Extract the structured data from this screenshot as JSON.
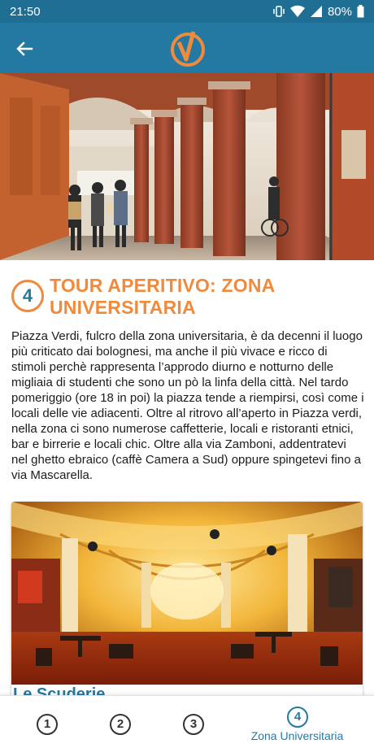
{
  "status_bar": {
    "time": "21:50",
    "battery": "80%"
  },
  "app_bar": {
    "back_icon": "arrow-left-icon",
    "logo_icon": "checkmark-circle-logo-icon",
    "colors": {
      "bar": "#2479a2",
      "status": "#1f6e93",
      "accent": "#f08a3c"
    }
  },
  "section": {
    "number": "4",
    "title": "TOUR APERITIVO: ZONA UNIVERSITARIA",
    "body": "Piazza Verdi, fulcro della zona universitaria, è da decenni il luogo più criticato dai bolognesi, ma anche il più vivace e ricco di stimoli perchè rappresenta l’approdo diurno e notturno delle migliaia di studenti che sono un pò la linfa della città. Nel tardo pomeriggio (ore 18 in poi) la piazza tende a riempirsi, così come i locali delle vie adiacenti. Oltre al ritrovo all’aperto in Piazza verdi, nella zona ci sono numerose caffetterie, locali e ristoranti etnici, bar e birrerie e locali chic. Oltre alla via Zamboni, addentratevi nel ghetto ebraico (caffè Camera a Sud) oppure spingetevi fino a via Mascarella."
  },
  "venue": {
    "name": "Le Scuderie"
  },
  "bottom_nav": {
    "items": [
      {
        "number": "1",
        "label": ""
      },
      {
        "number": "2",
        "label": ""
      },
      {
        "number": "3",
        "label": ""
      },
      {
        "number": "4",
        "label": "Zona Universitaria"
      }
    ],
    "active_index": 3
  }
}
